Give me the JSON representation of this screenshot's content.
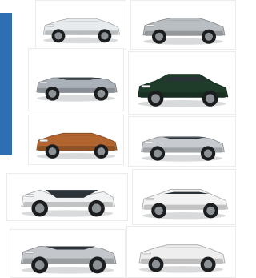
{
  "colors": {
    "accent": "#2e6fb4",
    "background": "#ffffff"
  },
  "cars": [
    {
      "name": "car-mach-e-white",
      "body": "#e7ebee",
      "shape": "suv"
    },
    {
      "name": "car-niro-silver",
      "body": "#b9bec2",
      "shape": "suv"
    },
    {
      "name": "car-ev6-silver",
      "body": "#aab1b8",
      "shape": "fastback"
    },
    {
      "name": "car-kona-green",
      "body": "#1f3b2a",
      "shape": "suv"
    },
    {
      "name": "car-ariya-copper",
      "body": "#b3652f",
      "shape": "suv"
    },
    {
      "name": "car-ioniq5-silver",
      "body": "#c7cbcf",
      "shape": "hatch"
    },
    {
      "name": "car-model-y-white",
      "body": "#f1f2f3",
      "shape": "fastback"
    },
    {
      "name": "car-id4-white",
      "body": "#f3f3f3",
      "shape": "suv"
    },
    {
      "name": "car-bz4x-silver",
      "body": "#c3c7cb",
      "shape": "suv"
    },
    {
      "name": "car-blazer-ev-white",
      "body": "#eeeeee",
      "shape": "suv"
    }
  ]
}
